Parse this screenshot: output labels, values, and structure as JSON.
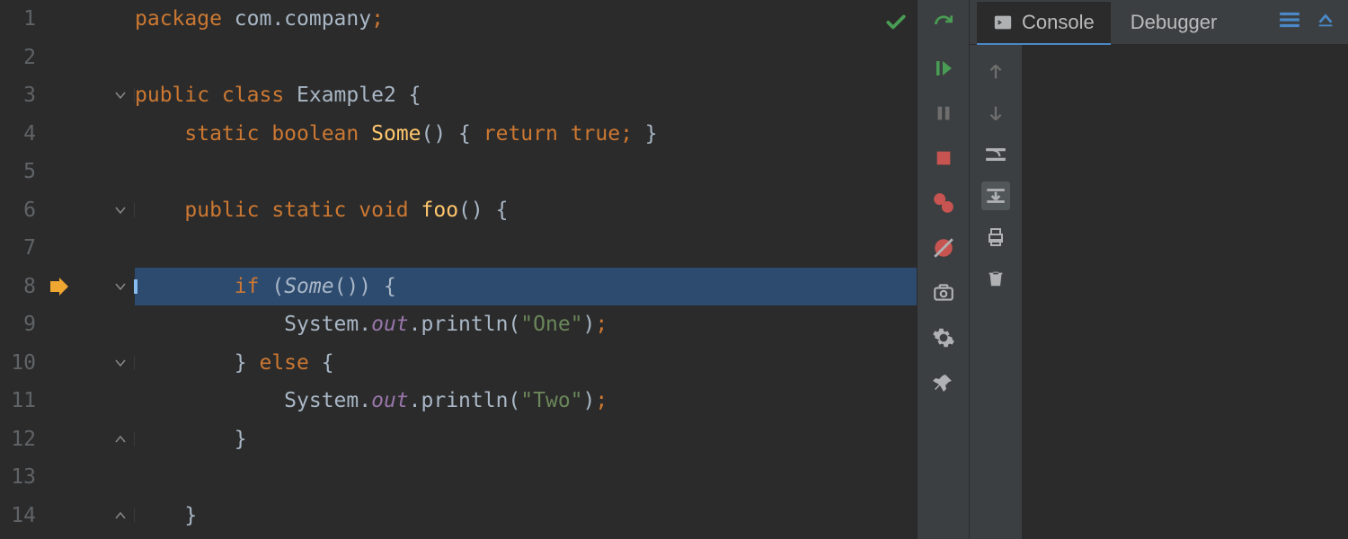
{
  "editor": {
    "current_line": 8,
    "lines": [
      {
        "n": 1,
        "fold": false,
        "tokens": [
          [
            "",
            "package "
          ],
          [
            "kw",
            "package"
          ],
          [
            "",
            " "
          ],
          [
            "ident",
            "com.company"
          ],
          [
            "semi",
            ";"
          ]
        ],
        "raw": "package com.company;",
        "segments": [
          {
            "cls": "kw",
            "t": "package"
          },
          {
            "cls": "",
            "t": " com.company"
          },
          {
            "cls": "semi",
            "t": ";"
          }
        ]
      },
      {
        "n": 2,
        "segments": []
      },
      {
        "n": 3,
        "fold": "open",
        "segments": [
          {
            "cls": "kw",
            "t": "public class"
          },
          {
            "cls": "",
            "t": " Example2 {"
          }
        ]
      },
      {
        "n": 4,
        "segments": [
          {
            "cls": "",
            "t": "    "
          },
          {
            "cls": "kw",
            "t": "static boolean"
          },
          {
            "cls": "",
            "t": " "
          },
          {
            "cls": "method",
            "t": "Some"
          },
          {
            "cls": "",
            "t": "() { "
          },
          {
            "cls": "kw",
            "t": "return true"
          },
          {
            "cls": "semi",
            "t": ";"
          },
          {
            "cls": "",
            "t": " }"
          }
        ]
      },
      {
        "n": 5,
        "segments": []
      },
      {
        "n": 6,
        "fold": "open",
        "segments": [
          {
            "cls": "",
            "t": "    "
          },
          {
            "cls": "kw",
            "t": "public static void"
          },
          {
            "cls": "",
            "t": " "
          },
          {
            "cls": "method",
            "t": "foo"
          },
          {
            "cls": "",
            "t": "() {"
          }
        ]
      },
      {
        "n": 7,
        "segments": []
      },
      {
        "n": 8,
        "fold": "open",
        "exec": true,
        "segments": [
          {
            "cls": "",
            "t": "        "
          },
          {
            "cls": "kw",
            "t": "if"
          },
          {
            "cls": "",
            "t": " ("
          },
          {
            "cls": "",
            "t": "Some",
            "italic": true
          },
          {
            "cls": "",
            "t": "()) {"
          }
        ]
      },
      {
        "n": 9,
        "segments": [
          {
            "cls": "",
            "t": "            System."
          },
          {
            "cls": "field",
            "t": "out"
          },
          {
            "cls": "",
            "t": ".println("
          },
          {
            "cls": "str",
            "t": "\"One\""
          },
          {
            "cls": "",
            "t": ")"
          },
          {
            "cls": "semi",
            "t": ";"
          }
        ]
      },
      {
        "n": 10,
        "fold": "open",
        "segments": [
          {
            "cls": "",
            "t": "        } "
          },
          {
            "cls": "kw",
            "t": "else"
          },
          {
            "cls": "",
            "t": " {"
          }
        ]
      },
      {
        "n": 11,
        "segments": [
          {
            "cls": "",
            "t": "            System."
          },
          {
            "cls": "field",
            "t": "out"
          },
          {
            "cls": "",
            "t": ".println("
          },
          {
            "cls": "str",
            "t": "\"Two\""
          },
          {
            "cls": "",
            "t": ")"
          },
          {
            "cls": "semi",
            "t": ";"
          }
        ]
      },
      {
        "n": 12,
        "fold": "close",
        "segments": [
          {
            "cls": "",
            "t": "        }"
          }
        ]
      },
      {
        "n": 13,
        "segments": []
      },
      {
        "n": 14,
        "fold": "close",
        "segments": [
          {
            "cls": "",
            "t": "    }"
          }
        ]
      }
    ]
  },
  "run_toolbar": {
    "rerun": "rerun-icon",
    "resume": "resume-icon",
    "pause": "pause-icon",
    "stop": "stop-icon",
    "breakpoints": "view-breakpoints-icon",
    "mute": "mute-breakpoints-icon",
    "camera": "thread-dump-icon",
    "settings": "settings-icon",
    "pin": "pin-icon"
  },
  "debug_panel": {
    "tabs": {
      "console": "Console",
      "debugger": "Debugger"
    },
    "side": {
      "up": "frames-up-icon",
      "down": "frames-down-icon",
      "restart_frame": "restart-frame-icon",
      "filter_frames": "nav-to-source-icon",
      "print": "print-icon",
      "trash": "trash-icon"
    }
  },
  "colors": {
    "keyword": "#cc7832",
    "string": "#6a8759",
    "method": "#ffc66d",
    "field": "#9876aa",
    "accent": "#4a88c7",
    "exec_arrow": "#f0a732",
    "ok_green": "#499c54",
    "stop_red": "#c75450"
  }
}
